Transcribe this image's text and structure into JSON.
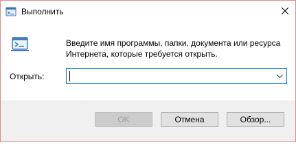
{
  "window": {
    "title": "Выполнить"
  },
  "description": "Введите имя программы, папки, документа или ресурса Интернета, которые требуется открыть.",
  "open_field": {
    "label": "Открыть:",
    "value": ""
  },
  "buttons": {
    "ok": "OK",
    "cancel": "Отмена",
    "browse": "Обзор..."
  },
  "icons": {
    "title": "run-icon",
    "main": "run-icon",
    "close": "close-icon",
    "dropdown": "chevron-down-icon"
  },
  "colors": {
    "border": "#e08a8a",
    "focus": "#0078d7",
    "footer_bg": "#f0f0f0"
  }
}
